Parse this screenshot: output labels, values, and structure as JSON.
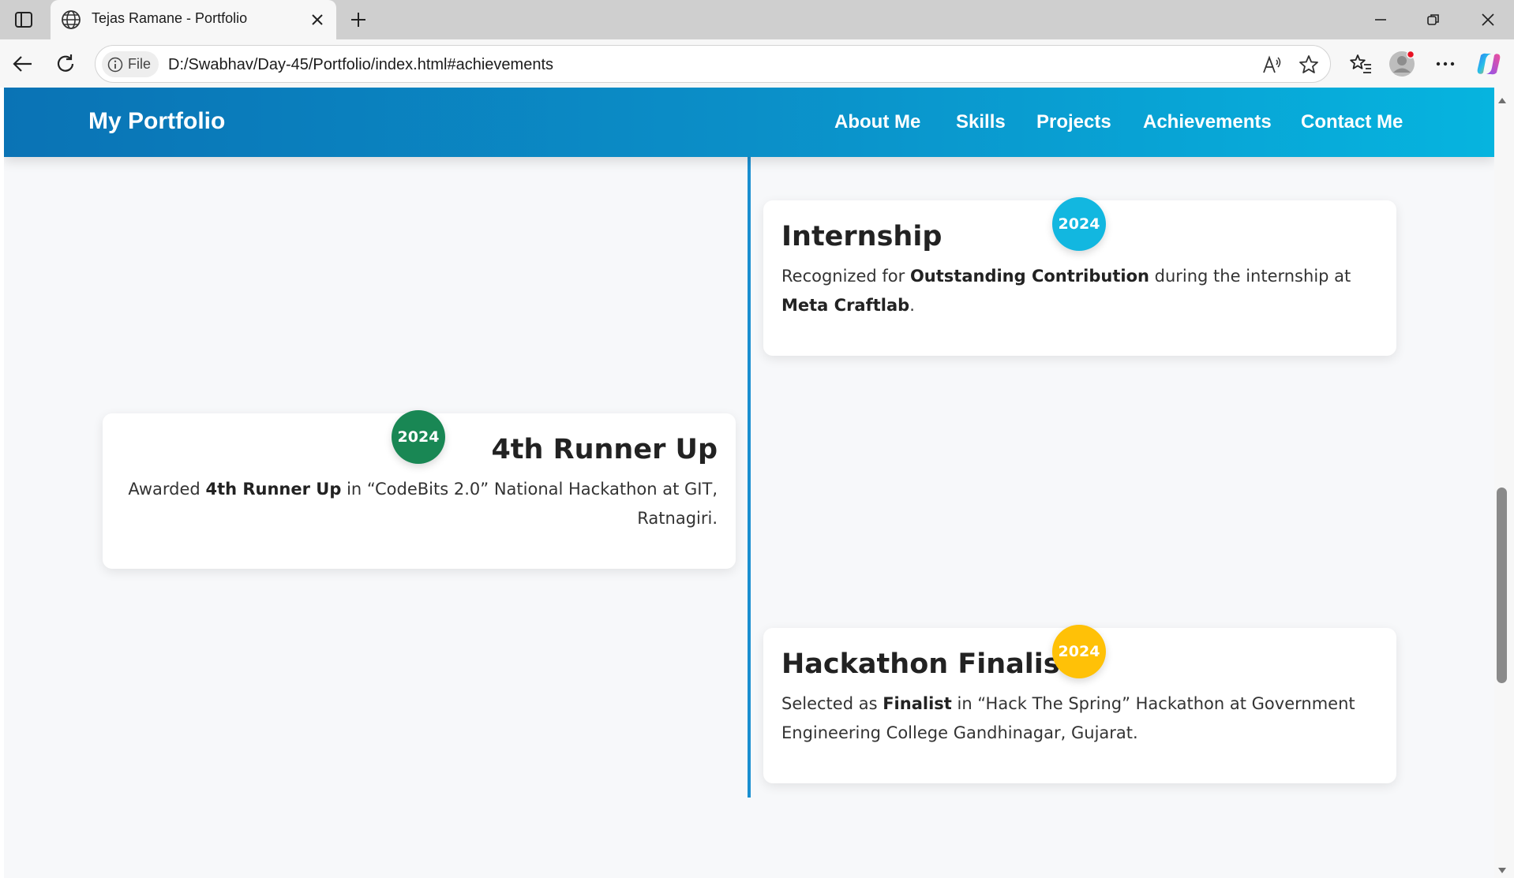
{
  "browser": {
    "tab_title": "Tejas Ramane - Portfolio",
    "site_chip_label": "File",
    "url": "D:/Swabhav/Day-45/Portfolio/index.html#achievements"
  },
  "page": {
    "brand": "My Portfolio",
    "nav": [
      {
        "label": "About Me"
      },
      {
        "label": "Skills"
      },
      {
        "label": "Projects"
      },
      {
        "label": "Achievements"
      },
      {
        "label": "Contact Me"
      }
    ],
    "achievements": [
      {
        "year": "2024",
        "badge_color": "#12b7e0",
        "title": "Internship",
        "desc_parts": [
          "Recognized for ",
          "Outstanding Contribution",
          " during the internship at ",
          "Meta Craftlab",
          "."
        ]
      },
      {
        "year": "2024",
        "badge_color": "#198754",
        "title": "4th Runner Up",
        "desc_parts": [
          "Awarded ",
          "4th Runner Up",
          " in “CodeBits 2.0” National Hackathon at GIT, Ratnagiri."
        ]
      },
      {
        "year": "2024",
        "badge_color": "#ffc107",
        "title": "Hackathon Finalist",
        "desc_parts": [
          "Selected as ",
          "Finalist",
          " in “Hack The Spring” Hackathon at Government Engineering College Gandhinagar, Gujarat."
        ]
      }
    ]
  },
  "colors": {
    "navbar_gradient_start": "#0a73b5",
    "navbar_gradient_end": "#06b4df",
    "timeline_line": "#1a8fd0",
    "page_bg": "#f7f8fa"
  },
  "icons": {
    "tab_actions": "tab-actions-icon",
    "favicon": "globe-icon",
    "tab_close": "close-icon",
    "new_tab": "plus-icon",
    "back": "back-arrow-icon",
    "reload": "reload-icon",
    "info": "info-icon",
    "read_aloud": "read-aloud-icon",
    "favorite": "star-icon",
    "favorites": "favorites-icon",
    "profile": "profile-avatar-icon",
    "more": "more-icon",
    "copilot": "copilot-icon"
  }
}
